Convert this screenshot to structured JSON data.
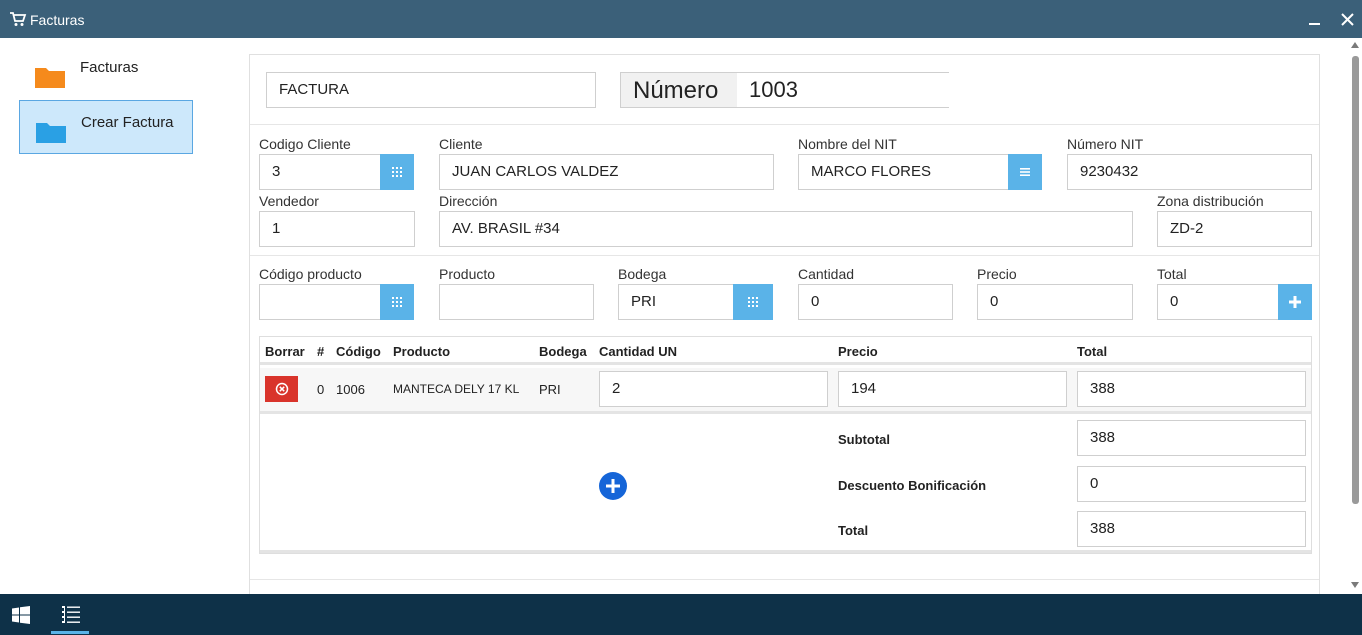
{
  "window": {
    "title": "Facturas"
  },
  "sidebar": {
    "items": [
      {
        "label": "Facturas",
        "active": false,
        "folder_color": "#f58a1c"
      },
      {
        "label": "Crear Factura",
        "active": true,
        "folder_color": "#2aa0e4"
      }
    ]
  },
  "header": {
    "doc_type": "FACTURA",
    "numero_label": "Número",
    "numero_value": "1003"
  },
  "form": {
    "codigo_cliente": {
      "label": "Codigo Cliente",
      "value": "3"
    },
    "cliente": {
      "label": "Cliente",
      "value": "JUAN CARLOS VALDEZ"
    },
    "nombre_nit": {
      "label": "Nombre del NIT",
      "value": "MARCO FLORES"
    },
    "numero_nit": {
      "label": "Número NIT",
      "value": "9230432"
    },
    "vendedor": {
      "label": "Vendedor",
      "value": "1"
    },
    "direccion": {
      "label": "Dirección",
      "value": "AV. BRASIL #34"
    },
    "zona": {
      "label": "Zona distribución",
      "value": "ZD-2"
    }
  },
  "product_entry": {
    "codigo_producto": {
      "label": "Código producto",
      "value": ""
    },
    "producto": {
      "label": "Producto",
      "value": ""
    },
    "bodega": {
      "label": "Bodega",
      "value": "PRI"
    },
    "cantidad": {
      "label": "Cantidad",
      "value": "0"
    },
    "precio": {
      "label": "Precio",
      "value": "0"
    },
    "total": {
      "label": "Total",
      "value": "0"
    }
  },
  "table": {
    "headers": [
      "Borrar",
      "#",
      "Código",
      "Producto",
      "Bodega",
      "Cantidad UN",
      "Precio",
      "Total"
    ],
    "rows": [
      {
        "index": "0",
        "codigo": "1006",
        "producto": "MANTECA DELY 17 KL",
        "bodega": "PRI",
        "cantidad": "2",
        "precio": "194",
        "total": "388"
      }
    ]
  },
  "summary": {
    "subtotal_label": "Subtotal",
    "subtotal": "388",
    "descuento_label": "Descuento Bonificación",
    "descuento": "0",
    "total_label": "Total",
    "total": "388"
  },
  "colors": {
    "titlebar": "#3b6079",
    "accent": "#5ab3e8",
    "delete": "#d9342b",
    "add_circle": "#1565d8",
    "taskbar": "#0e3148"
  }
}
